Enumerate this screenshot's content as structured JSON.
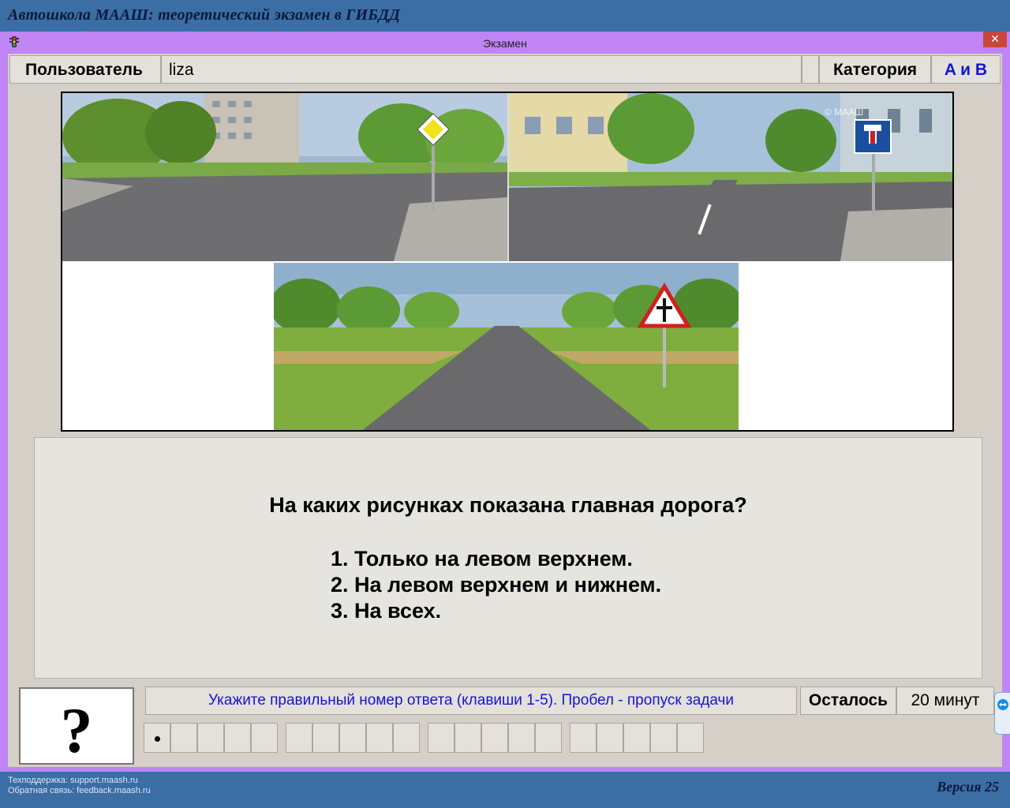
{
  "app": {
    "title": "Автошкола МААШ: теоретический экзамен в ГИБДД"
  },
  "window": {
    "title": "Экзамен",
    "close_label": "✕"
  },
  "header": {
    "user_label": "Пользователь",
    "user_value": "liza",
    "category_label": "Категория",
    "category_value": "A и B"
  },
  "illustration": {
    "watermark": "© МААШ",
    "panels": [
      {
        "sign": "main-road-sign"
      },
      {
        "sign": "dead-end-sign"
      },
      {
        "sign": "crossroad-secondary-sign"
      }
    ]
  },
  "question": {
    "text": "На каких рисунках показана главная дорога?",
    "answers": [
      "1. Только на левом верхнем.",
      "2. На левом верхнем и нижнем.",
      "3. На всех."
    ]
  },
  "status": {
    "help_symbol": "?",
    "hint": "Укажите правильный номер ответа (клавиши 1-5). Пробел - пропуск задачи",
    "remaining_label": "Осталось",
    "remaining_value": "20 минут",
    "questions_total": 20,
    "current_question": 1
  },
  "footer": {
    "support": "Техподдержка: support.maash.ru",
    "feedback": "Обратная связь: feedback.maash.ru",
    "version": "Версия 25"
  },
  "colors": {
    "desktop": "#3a6ea5",
    "window_frame": "#c084f4",
    "client_bg": "#d4d0c8",
    "hint_text": "#1414d8",
    "category_value": "#1414d8"
  }
}
